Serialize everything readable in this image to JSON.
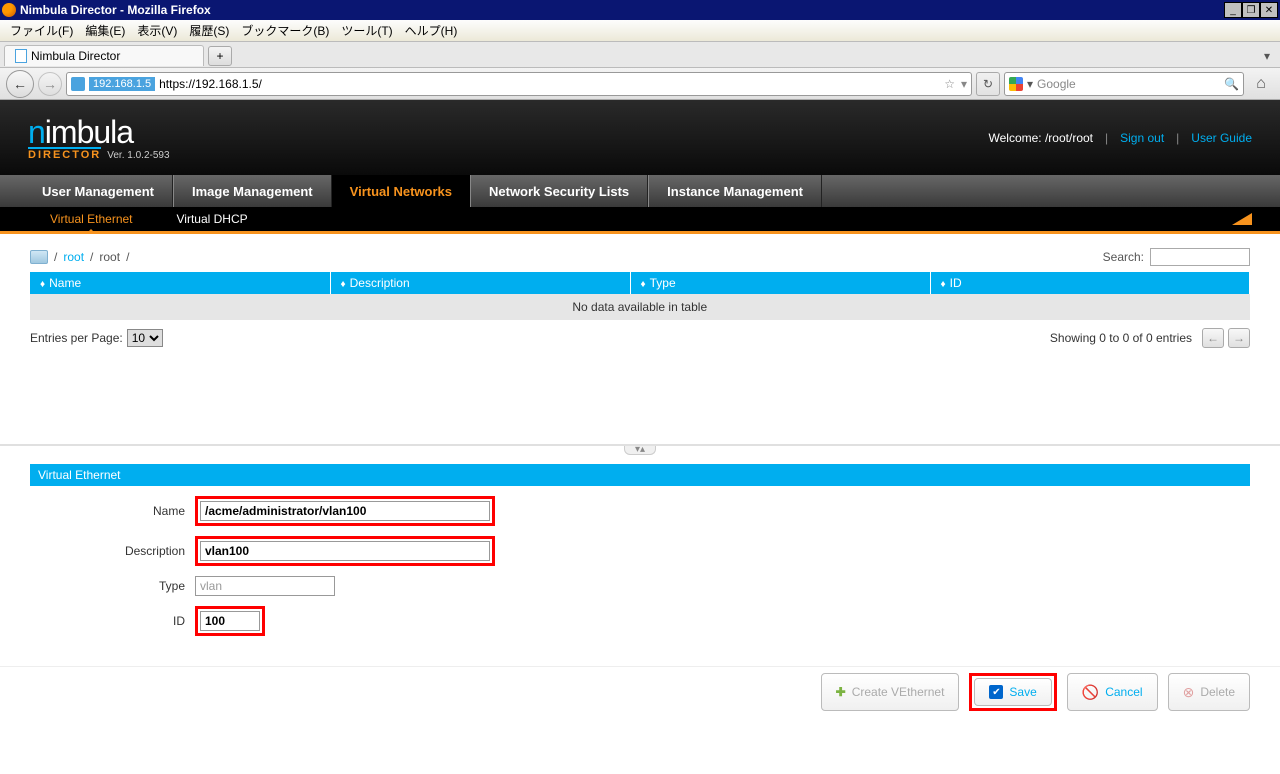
{
  "window": {
    "title": "Nimbula Director - Mozilla Firefox"
  },
  "menubar": {
    "file": "ファイル(F)",
    "edit": "編集(E)",
    "view": "表示(V)",
    "history": "履歴(S)",
    "bookmarks": "ブックマーク(B)",
    "tools": "ツール(T)",
    "help": "ヘルプ(H)"
  },
  "tab": {
    "title": "Nimbula Director",
    "plus": "+"
  },
  "urlbar": {
    "badge": "192.168.1.5",
    "url": "https://192.168.1.5/",
    "star": "☆",
    "search_placeholder": "Google"
  },
  "header": {
    "logo1": "n",
    "logo2": "imbula",
    "director": "DIRECTOR",
    "version": "Ver. 1.0.2-593",
    "welcome": "Welcome: /root/root",
    "signout": "Sign out",
    "userguide": "User Guide"
  },
  "mainnav": {
    "user": "User Management",
    "image": "Image Management",
    "vnet": "Virtual Networks",
    "nsec": "Network Security Lists",
    "inst": "Instance Management"
  },
  "subnav": {
    "veth": "Virtual Ethernet",
    "dhcp": "Virtual DHCP"
  },
  "breadcrumb": {
    "slash": "/",
    "root1": "root",
    "root2": "root"
  },
  "search": {
    "label": "Search:"
  },
  "table": {
    "col_name": "Name",
    "col_desc": "Description",
    "col_type": "Type",
    "col_id": "ID",
    "no_data": "No data available in table"
  },
  "footer": {
    "entries_label": "Entries per Page:",
    "entries_value": "10",
    "showing": "Showing 0 to 0 of 0 entries"
  },
  "form": {
    "header": "Virtual Ethernet",
    "name_label": "Name",
    "name_value": "/acme/administrator/vlan100",
    "desc_label": "Description",
    "desc_value": "vlan100",
    "type_label": "Type",
    "type_value": "vlan",
    "id_label": "ID",
    "id_value": "100"
  },
  "actions": {
    "create": "Create VEthernet",
    "save": "Save",
    "cancel": "Cancel",
    "delete": "Delete"
  }
}
